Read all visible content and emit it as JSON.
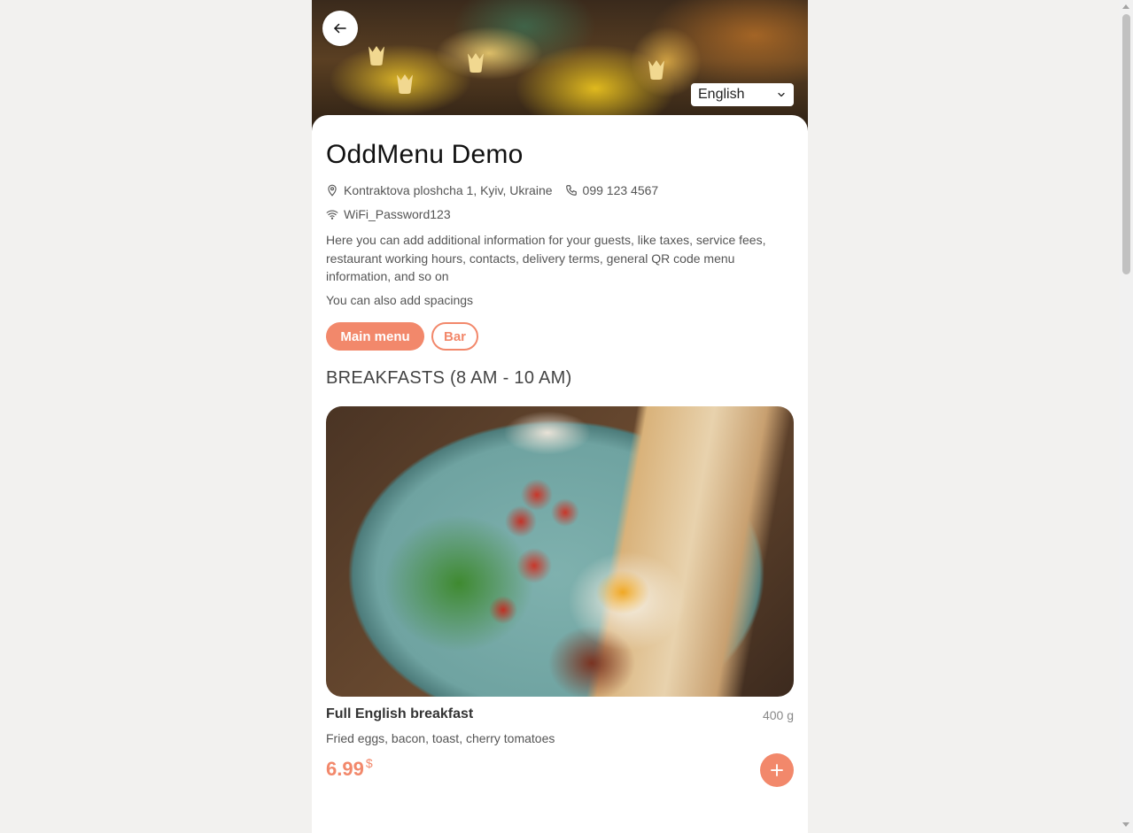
{
  "header": {
    "language": "English"
  },
  "restaurant": {
    "name": "OddMenu Demo",
    "address": "Kontraktova ploshcha 1, Kyiv, Ukraine",
    "phone": "099 123 4567",
    "wifi": "WiFi_Password123",
    "description": "Here you can add additional information for your guests, like taxes, service fees, restaurant working hours, contacts, delivery terms, general QR code menu information, and so on",
    "extra_note": "You can also add spacings"
  },
  "tabs": [
    {
      "label": "Main menu",
      "active": true
    },
    {
      "label": "Bar",
      "active": false
    }
  ],
  "section": {
    "title": "BREAKFASTS (8 AM - 10 AM)"
  },
  "dish": {
    "name": "Full English breakfast",
    "weight": "400 g",
    "description": "Fried eggs, bacon, toast, cherry tomatoes",
    "price": "6.99",
    "currency": "$"
  },
  "colors": {
    "accent": "#f2886b",
    "background": "#f2f1ef"
  }
}
